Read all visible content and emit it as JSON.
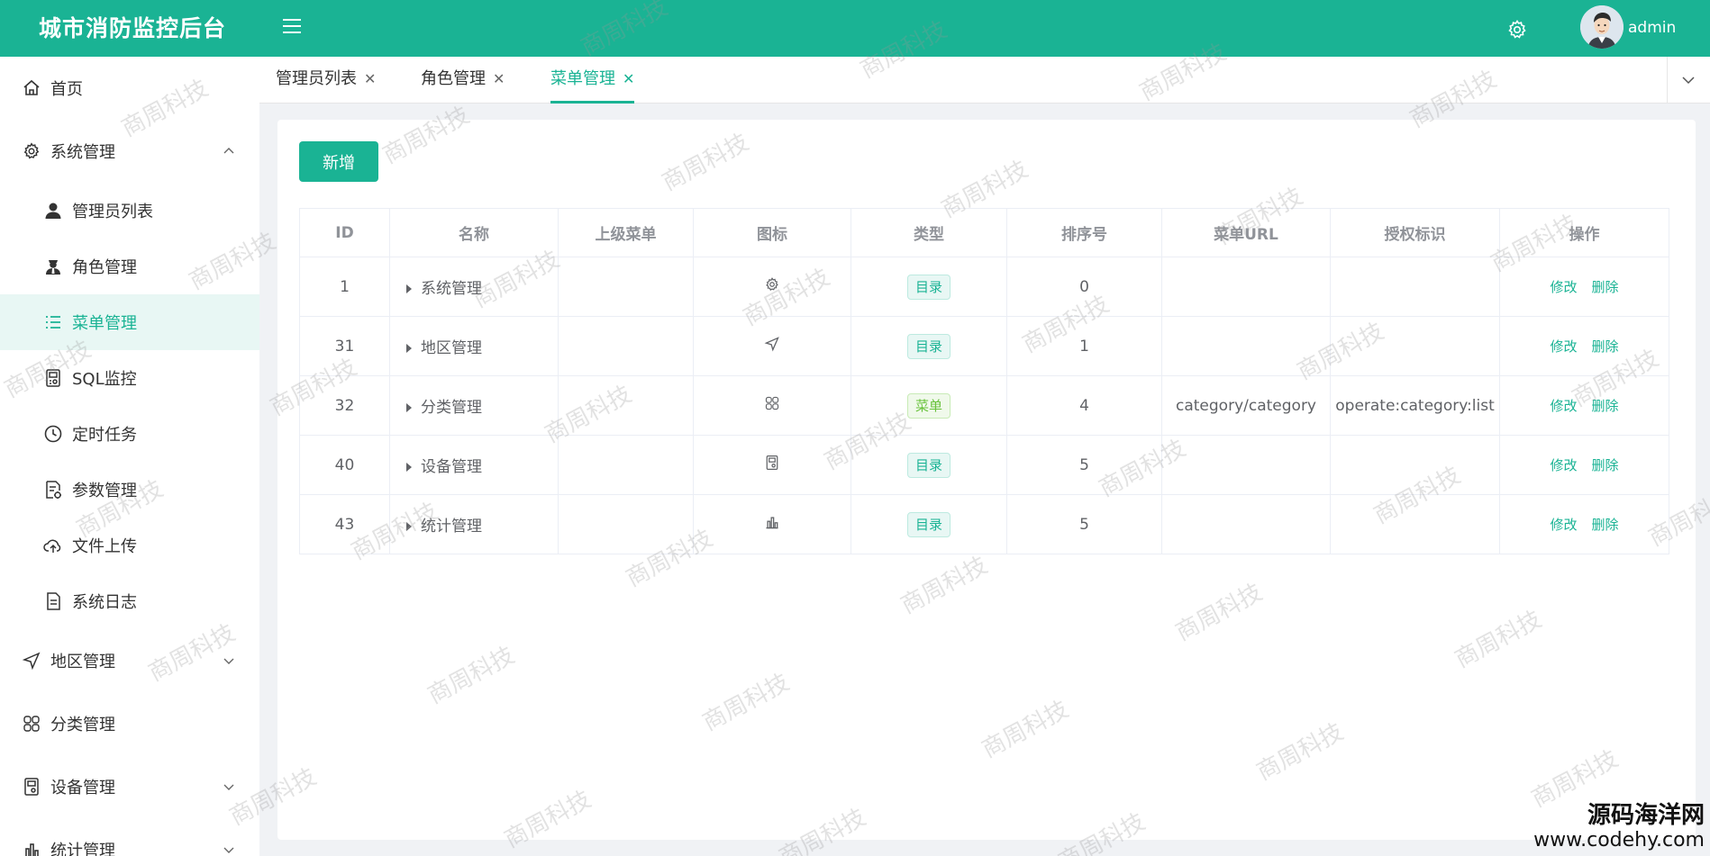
{
  "header": {
    "title": "城市消防监控后台",
    "username": "admin"
  },
  "sidebar": {
    "items": [
      {
        "label": "首页",
        "icon": "home-icon"
      },
      {
        "label": "系统管理",
        "icon": "gear-icon",
        "expanded": true
      },
      {
        "label": "管理员列表",
        "icon": "user-icon"
      },
      {
        "label": "角色管理",
        "icon": "user-role-icon"
      },
      {
        "label": "菜单管理",
        "icon": "list-icon",
        "active": true
      },
      {
        "label": "SQL监控",
        "icon": "monitor-icon"
      },
      {
        "label": "定时任务",
        "icon": "clock-icon"
      },
      {
        "label": "参数管理",
        "icon": "document-edit-icon"
      },
      {
        "label": "文件上传",
        "icon": "cloud-upload-icon"
      },
      {
        "label": "系统日志",
        "icon": "document-icon"
      },
      {
        "label": "地区管理",
        "icon": "navigation-icon"
      },
      {
        "label": "分类管理",
        "icon": "grid-icon"
      },
      {
        "label": "设备管理",
        "icon": "device-icon"
      },
      {
        "label": "统计管理",
        "icon": "bar-chart-icon"
      }
    ]
  },
  "tabs": [
    {
      "label": "管理员列表"
    },
    {
      "label": "角色管理"
    },
    {
      "label": "菜单管理",
      "active": true
    }
  ],
  "toolbar": {
    "add_label": "新增"
  },
  "table": {
    "headers": [
      "ID",
      "名称",
      "上级菜单",
      "图标",
      "类型",
      "排序号",
      "菜单URL",
      "授权标识",
      "操作"
    ],
    "rows": [
      {
        "id": "1",
        "name": "系统管理",
        "parent": "",
        "icon": "gear-icon",
        "type": "目录",
        "sort": "0",
        "url": "",
        "perm": ""
      },
      {
        "id": "31",
        "name": "地区管理",
        "parent": "",
        "icon": "navigation-icon",
        "type": "目录",
        "sort": "1",
        "url": "",
        "perm": ""
      },
      {
        "id": "32",
        "name": "分类管理",
        "parent": "",
        "icon": "grid-icon",
        "type": "菜单",
        "sort": "4",
        "url": "category/category",
        "perm": "operate:category:list"
      },
      {
        "id": "40",
        "name": "设备管理",
        "parent": "",
        "icon": "device-icon",
        "type": "目录",
        "sort": "5",
        "url": "",
        "perm": ""
      },
      {
        "id": "43",
        "name": "统计管理",
        "parent": "",
        "icon": "bar-chart-icon",
        "type": "目录",
        "sort": "5",
        "url": "",
        "perm": ""
      }
    ],
    "edit_label": "修改",
    "delete_label": "删除"
  },
  "watermark": {
    "text": "商周科技"
  },
  "corner_brand": {
    "name": "源码海洋网",
    "url": "www.codehy.com"
  },
  "colors": {
    "primary": "#1ab394",
    "menu_tag": "#67c23a"
  }
}
